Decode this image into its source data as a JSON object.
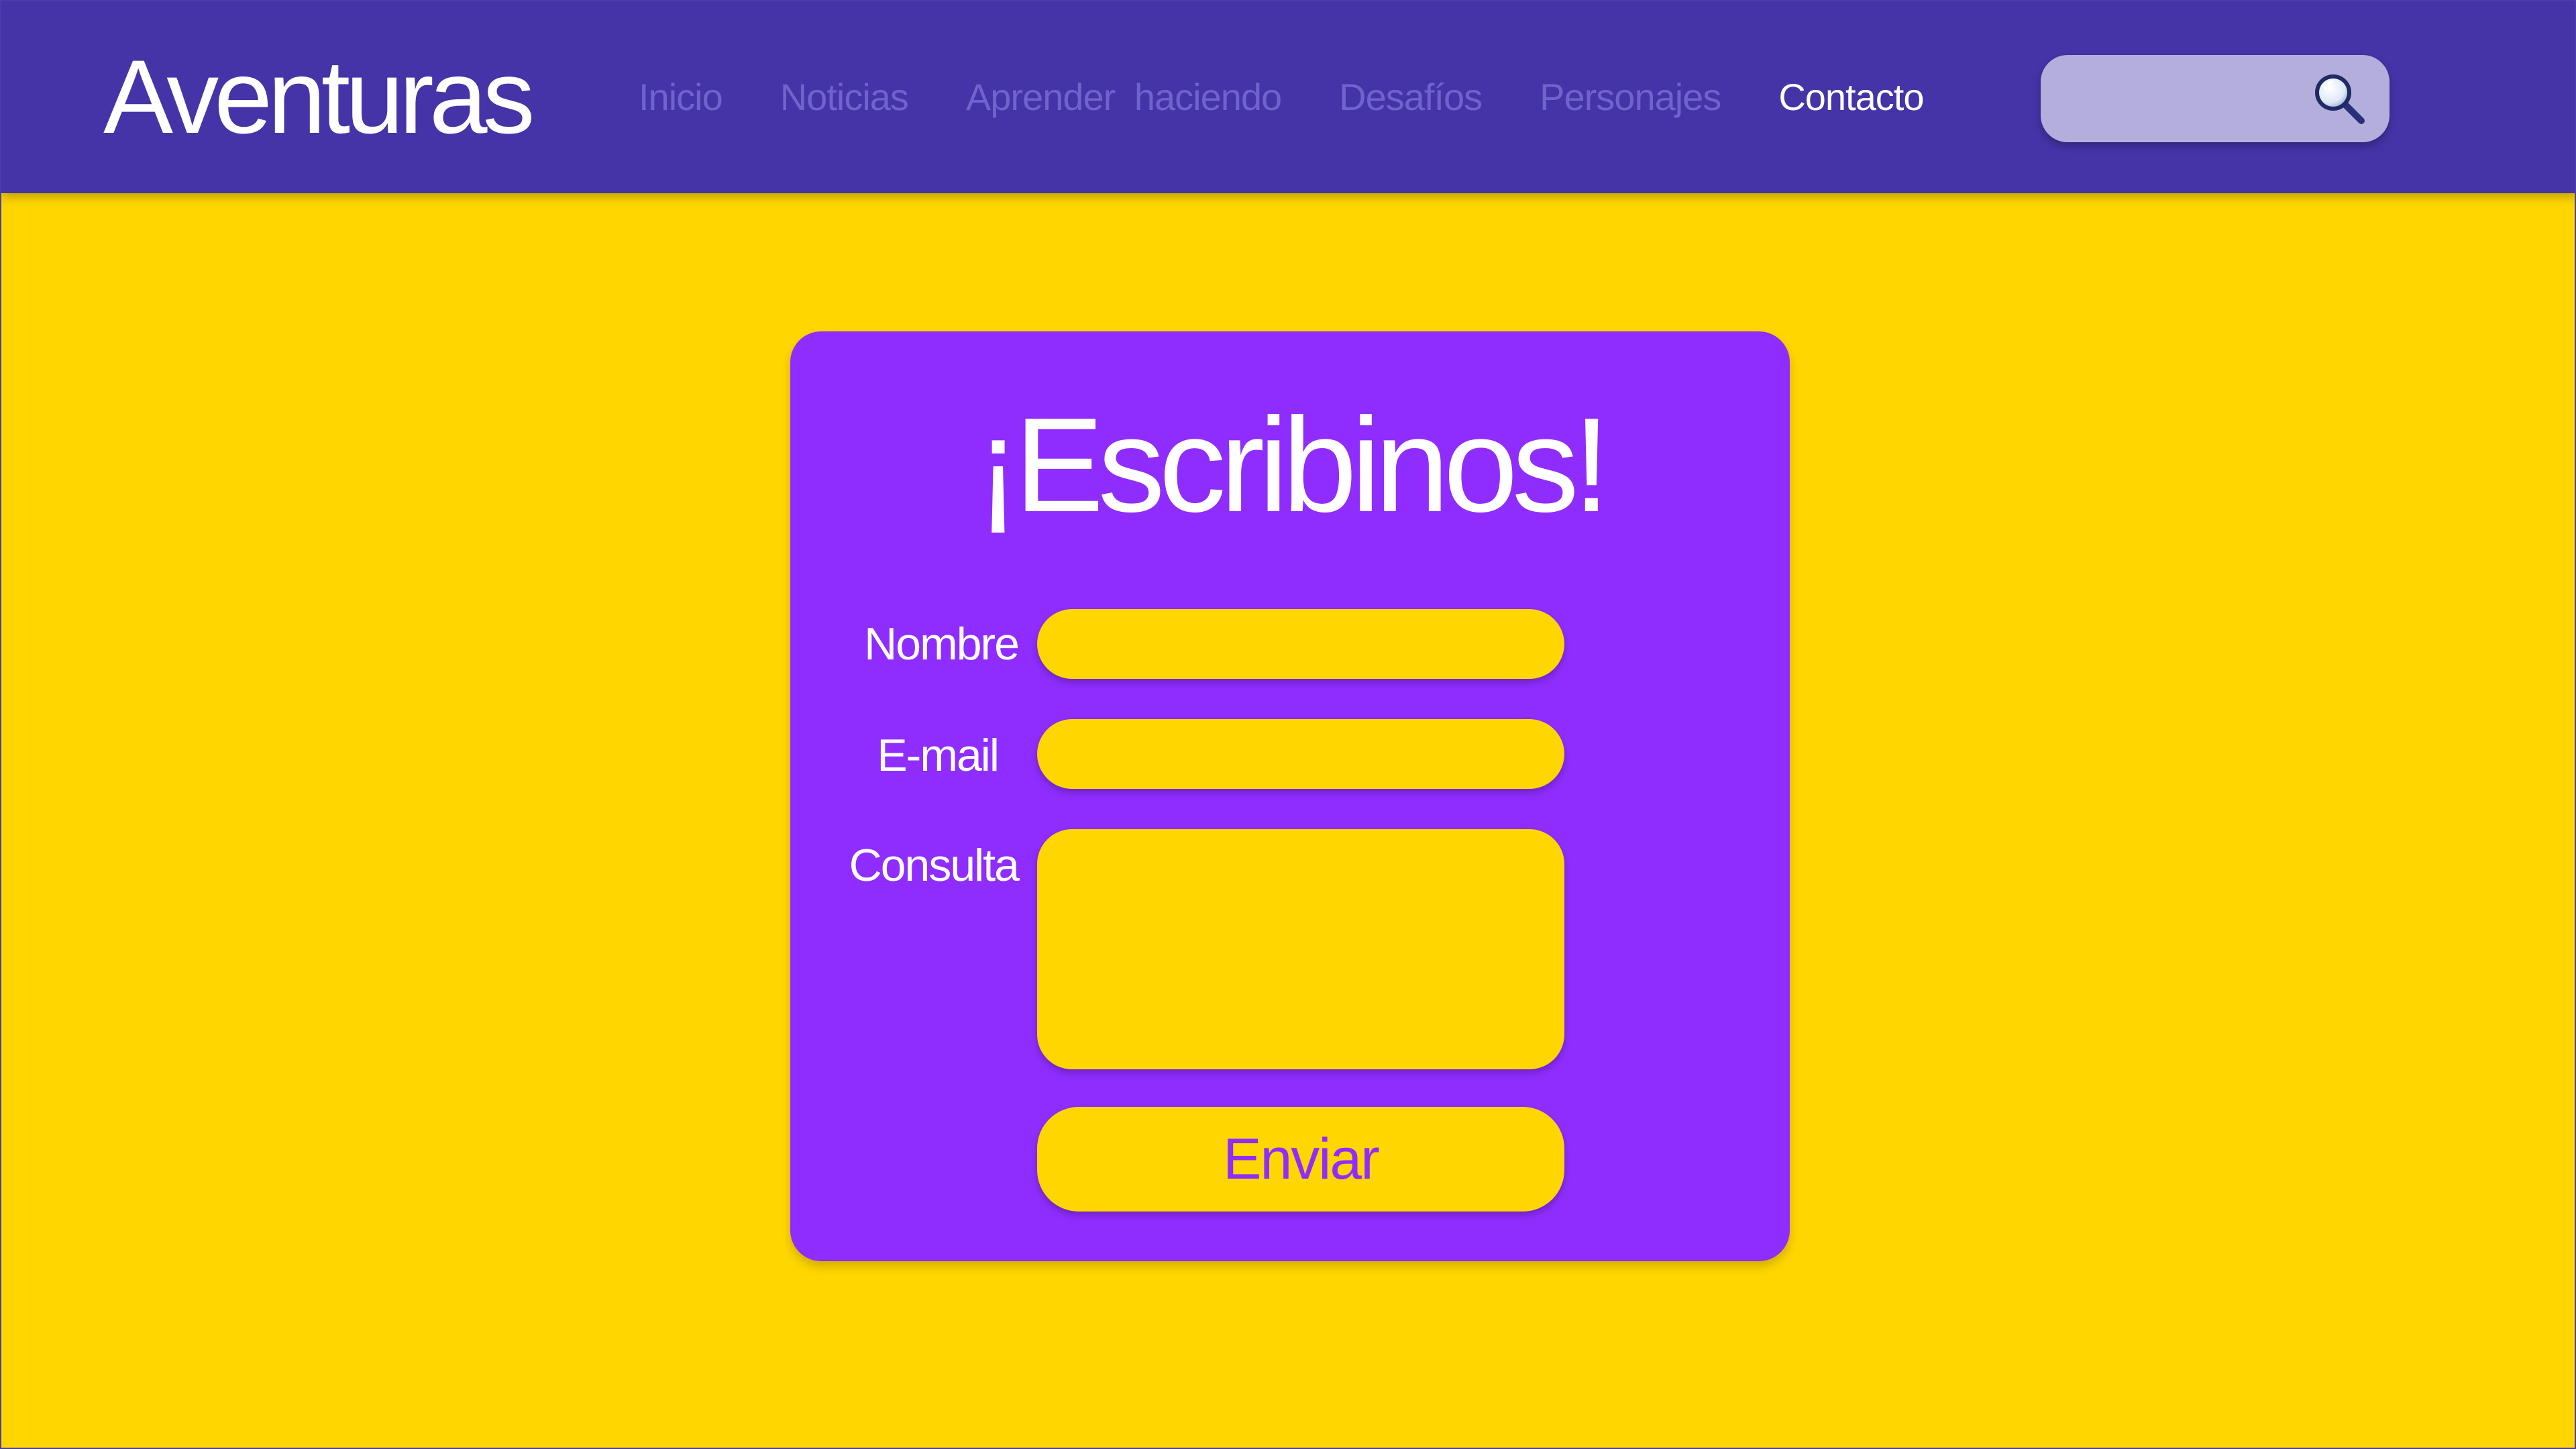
{
  "header": {
    "logo": "Aventuras",
    "nav": [
      {
        "label": "Inicio"
      },
      {
        "label": "Noticias"
      },
      {
        "label": "Aprender haciendo"
      },
      {
        "label": "Desafíos"
      },
      {
        "label": "Personajes"
      },
      {
        "label": "Contacto"
      }
    ],
    "active_nav": "Contacto",
    "search": {
      "value": "",
      "placeholder": ""
    }
  },
  "form": {
    "title": "¡Escribinos!",
    "fields": {
      "name": {
        "label": "Nombre",
        "value": ""
      },
      "email": {
        "label": "E-mail",
        "value": ""
      },
      "message": {
        "label": "Consulta",
        "value": ""
      }
    },
    "submit_label": "Enviar"
  },
  "colors": {
    "header_bg": "#4434A8",
    "page_bg": "#FFD600",
    "card_bg": "#8F2DFF",
    "nav_inactive": "#6F63CC",
    "nav_active": "#FFFFFF",
    "search_bg": "#B4AEDC",
    "button_text": "#8F2DFF"
  },
  "icons": {
    "search": "magnifying-glass-icon"
  }
}
